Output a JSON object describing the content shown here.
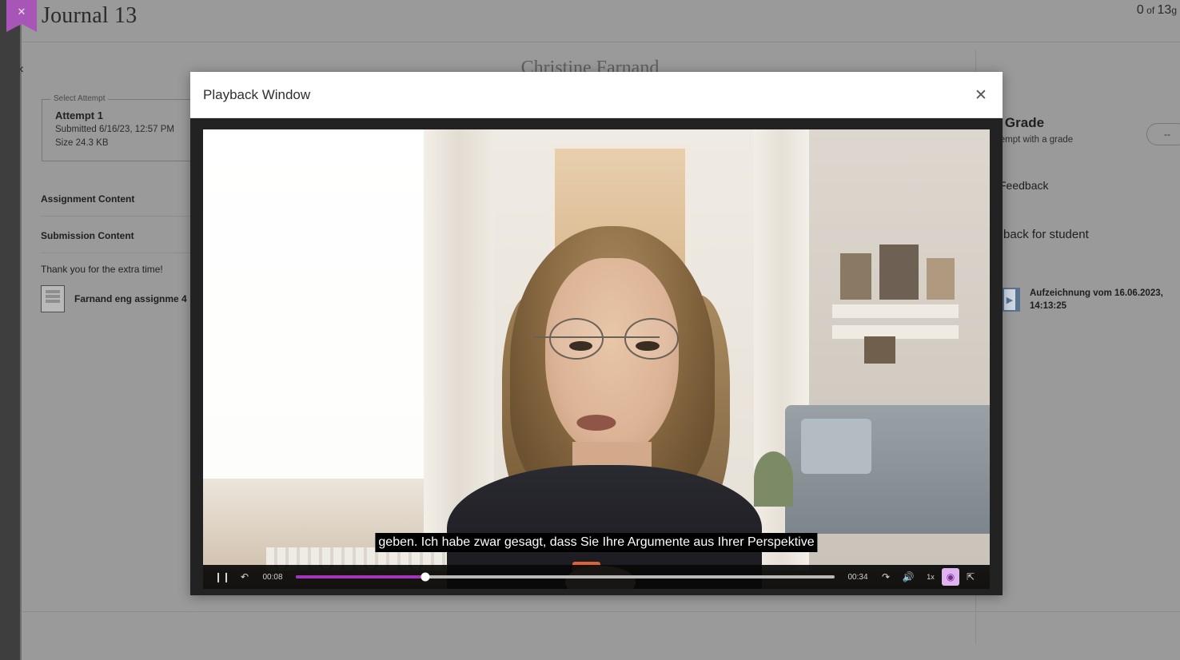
{
  "window": {
    "close_tab_icon": "close-icon",
    "page_title": "Journal 13",
    "counter_number": "0",
    "counter_of": " of ",
    "counter_total": "13",
    "counter_suffix": "g"
  },
  "nav": {
    "back_chevron_icon": "chevron-left-icon",
    "student_name": "Christine Farnand"
  },
  "submission": {
    "attempt_legend": "Select Attempt",
    "attempt_title": "Attempt 1",
    "attempt_submitted": "Submitted 6/16/23, 12:57 PM",
    "attempt_size": "Size 24.3 KB",
    "assignment_content_heading": "Assignment Content",
    "submission_content_heading": "Submission Content",
    "student_note": "Thank you for the extra time!",
    "attachment_icon": "document-icon",
    "attachment_name": "Farnand eng assignme 4"
  },
  "grading": {
    "final_grade_title": "al Grade",
    "final_grade_sub": "attempt with a grade",
    "grade_pill_value": "--",
    "feedback_label": "Feedback",
    "feedback_for_student": "eedback for student",
    "video_icon": "film-icon",
    "video_name": "Aufzeichnung vom 16.06.2023, 14:13:25"
  },
  "modal": {
    "title": "Playback Window",
    "close_icon": "close-icon"
  },
  "player": {
    "subtitle_text": "geben. Ich habe zwar gesagt, dass Sie Ihre Argumente aus Ihrer Perspektive",
    "pause_icon": "pause-icon",
    "replay_icon": "replay-icon",
    "current_time": "00:08",
    "duration": "00:34",
    "share_icon": "share-icon",
    "volume_icon": "volume-icon",
    "speed_label": "1x",
    "captions_icon": "captions-icon",
    "fullscreen_icon": "fullscreen-icon",
    "progress_percent": 24,
    "accent_color": "#a235bc",
    "active_control_bg": "#dfb3ef"
  }
}
